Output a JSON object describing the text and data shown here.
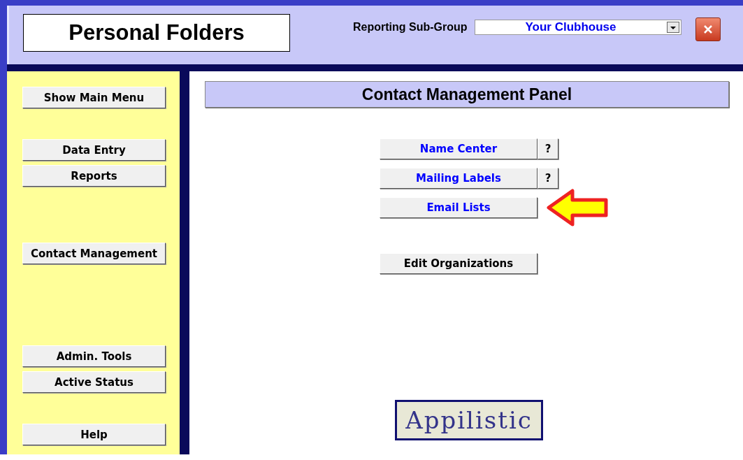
{
  "header": {
    "title": "Personal Folders",
    "subgroup_label": "Reporting Sub-Group",
    "subgroup_value": "Your Clubhouse"
  },
  "sidebar": {
    "groups": [
      [
        {
          "label": "Show Main Menu"
        }
      ],
      [
        {
          "label": "Data Entry"
        },
        {
          "label": "Reports"
        }
      ],
      [
        {
          "label": "Contact Management"
        }
      ],
      [
        {
          "label": "Admin. Tools"
        },
        {
          "label": "Active Status"
        }
      ],
      [
        {
          "label": "Help"
        }
      ]
    ]
  },
  "panel": {
    "title": "Contact Management Panel",
    "groups": [
      [
        {
          "label": "Name Center",
          "color": "#0000ff",
          "help": "?",
          "pointer": false
        },
        {
          "label": "Mailing Labels",
          "color": "#0000ff",
          "help": "?",
          "pointer": false
        },
        {
          "label": "Email Lists",
          "color": "#0000ff",
          "pointer": true
        }
      ],
      [
        {
          "label": "Edit Organizations",
          "color": "#000000",
          "pointer": false
        }
      ]
    ],
    "logo": "Appilistic"
  }
}
